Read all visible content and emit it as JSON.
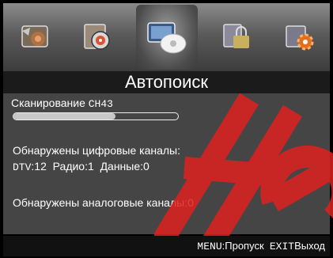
{
  "menu": {
    "icons": [
      {
        "name": "picture-icon",
        "selected": false
      },
      {
        "name": "sound-icon",
        "selected": false
      },
      {
        "name": "channel-icon",
        "selected": true
      },
      {
        "name": "lock-icon",
        "selected": false
      },
      {
        "name": "setup-icon",
        "selected": false
      }
    ]
  },
  "title": "Автопоиск",
  "scan": {
    "label": "Сканирование",
    "channel": "CH43",
    "progress_fraction": 0.62
  },
  "digital": {
    "heading": "Обнаружены цифровые каналы:",
    "dtv_label": "DTV",
    "dtv_value": ":12",
    "radio": "Радио:1",
    "data": "Данные:0"
  },
  "analog": {
    "heading": "Обнаружены аналоговые каналы:0"
  },
  "footer": {
    "menu_key": "MENU",
    "menu_action": ":Пропуск",
    "exit_key": "EXIT",
    "exit_action": "Выход"
  },
  "colors": {
    "watermark": "#e02020",
    "panel": "#454545",
    "title_bar": "#1b1b1b"
  }
}
